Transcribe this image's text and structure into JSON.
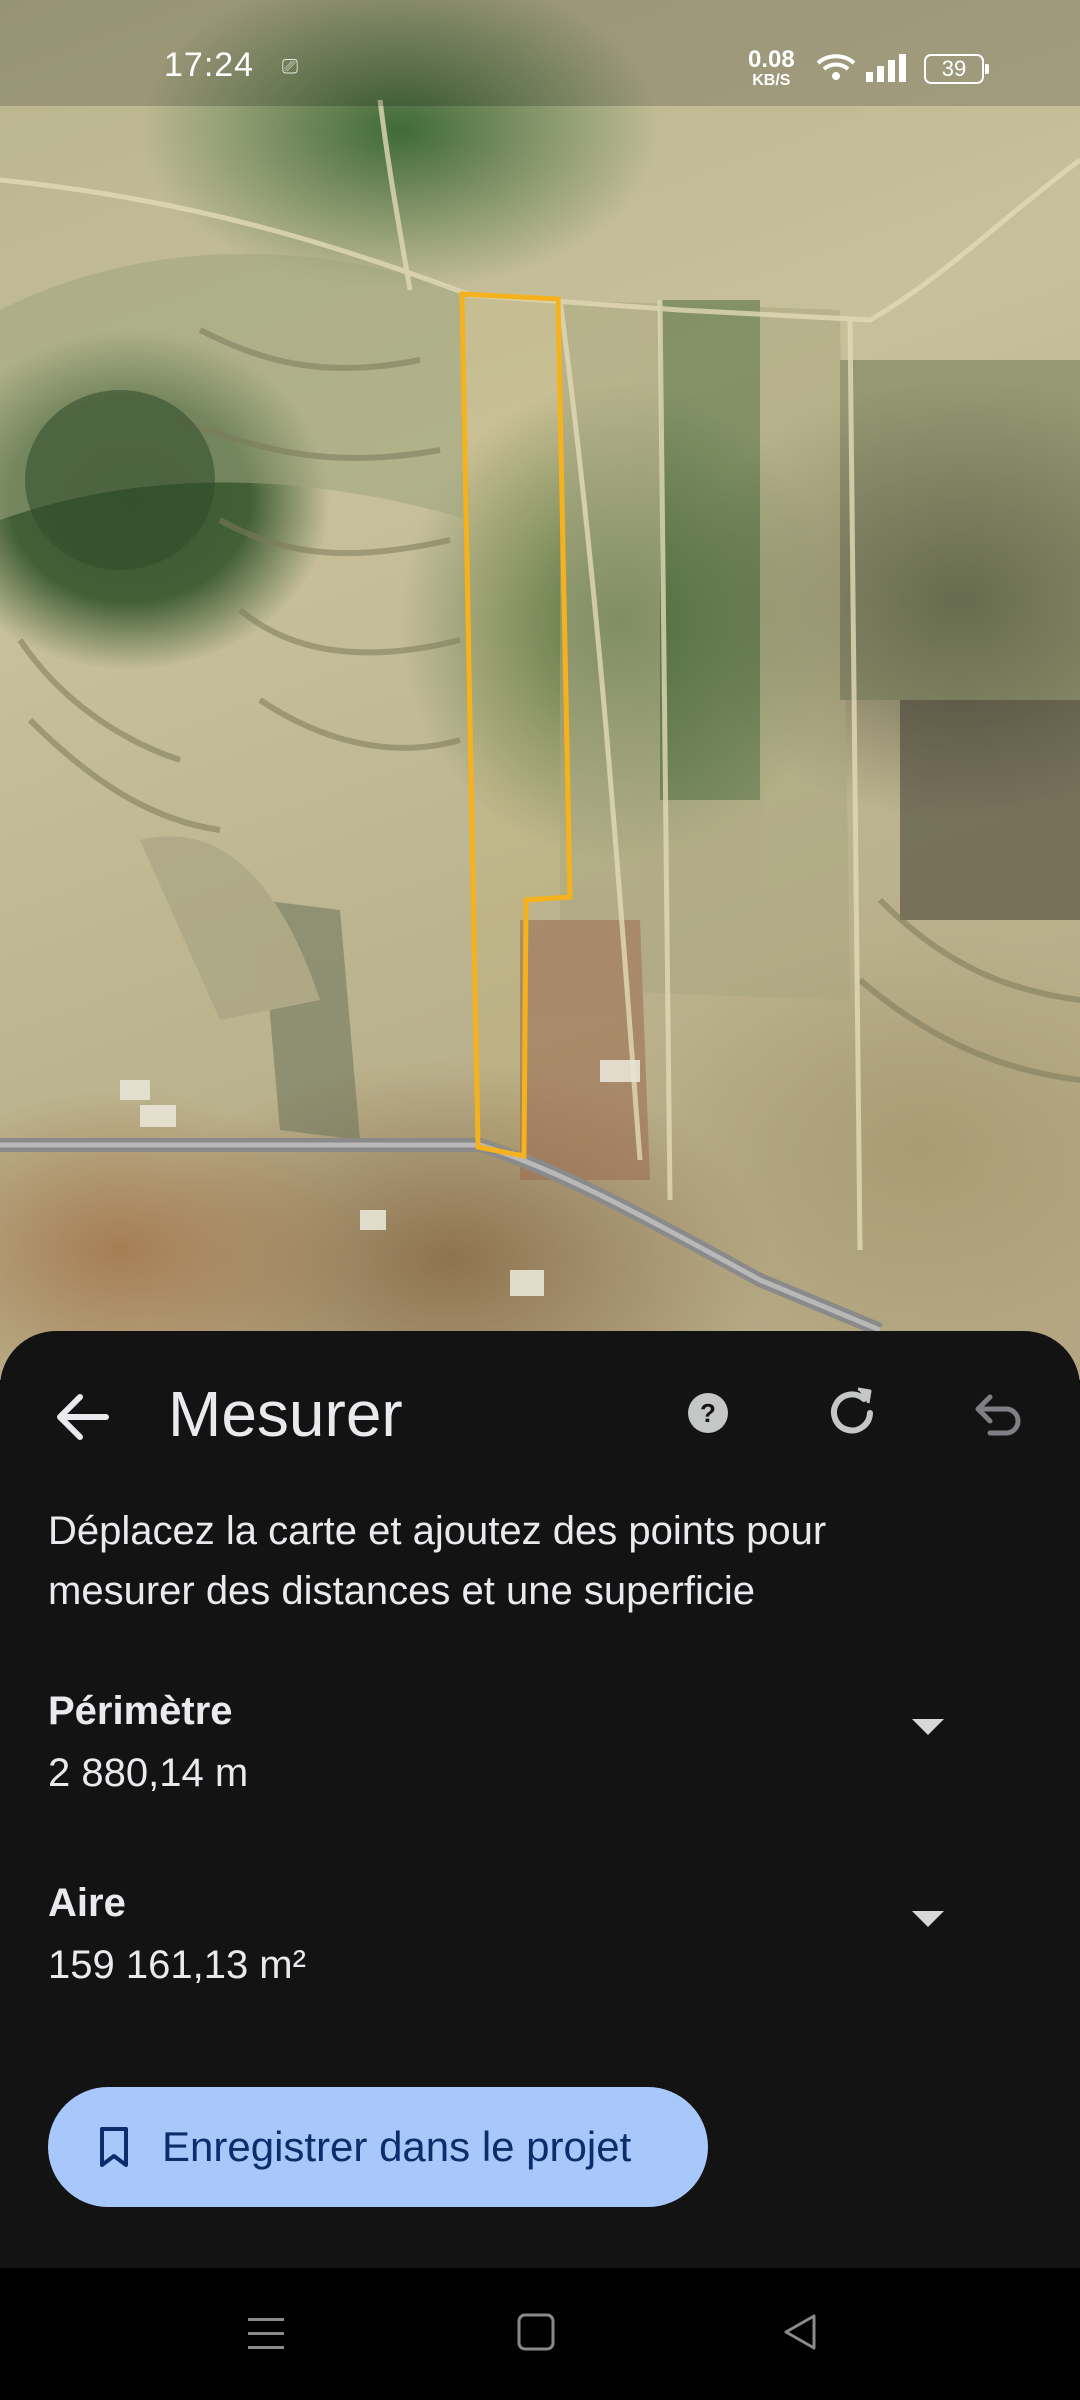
{
  "status_bar": {
    "time": "17:24",
    "speed_value": "0.08",
    "speed_unit": "KB/S",
    "battery": "39"
  },
  "map": {
    "layer": "satellite",
    "polygon_color": "#f5b21c"
  },
  "sheet": {
    "title": "Mesurer",
    "instructions": "Déplacez la carte et ajoutez des points pour mesurer des distances et une superficie",
    "perimeter": {
      "label": "Périmètre",
      "value": "2 880,14 m"
    },
    "area": {
      "label": "Aire",
      "value": "159 161,13 m²"
    },
    "save_button_label": "Enregistrer dans le projet",
    "icons": {
      "back": "arrow-back-icon",
      "help": "help-icon",
      "refresh": "refresh-icon",
      "undo": "undo-icon",
      "save": "bookmark-icon"
    }
  },
  "accent_color": "#a8c7fa"
}
